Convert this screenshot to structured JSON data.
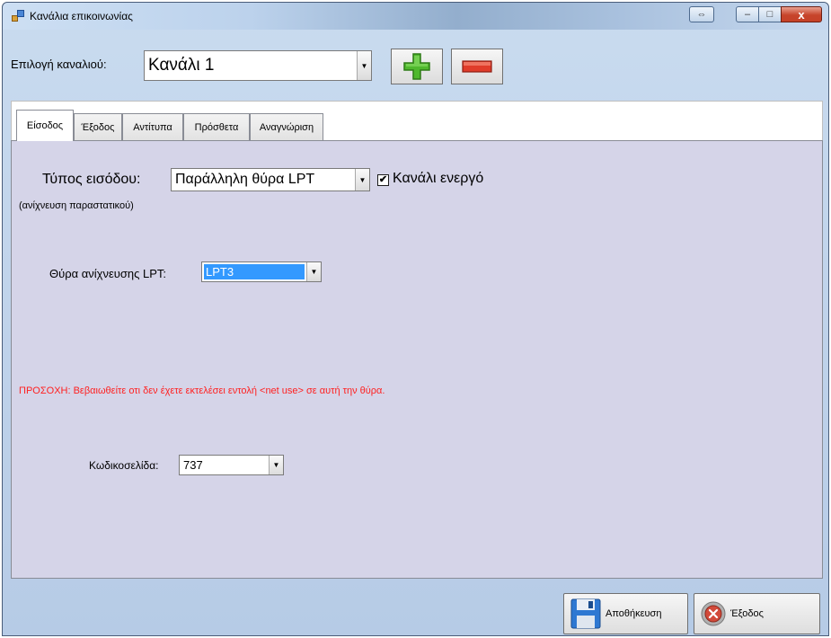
{
  "window": {
    "title": "Κανάλια επικοινωνίας",
    "min_glyph": "–",
    "max_glyph": "□",
    "close_glyph": "x",
    "swap_glyph": "⇔"
  },
  "toolbar": {
    "channel_label": "Επιλογή καναλιού:",
    "channel_value": "Κανάλι 1",
    "add_color": "#4fb82d",
    "remove_color": "#e03c2a"
  },
  "tabs": [
    {
      "label": "Είσοδος",
      "active": true
    },
    {
      "label": "Έξοδος"
    },
    {
      "label": "Αντίτυπα"
    },
    {
      "label": "Πρόσθετα"
    },
    {
      "label": "Αναγνώριση"
    }
  ],
  "input": {
    "type_label": "Τύπος εισόδου:",
    "type_value": "Παράλληλη θύρα LPT",
    "active_label": "Κανάλι ενεργό",
    "active_checked": true,
    "check_glyph": "✔",
    "note": "(ανίχνευση παραστατικού)",
    "lpt_label": "Θύρα ανίχνευσης LPT:",
    "lpt_value": "LPT3",
    "warning": "ΠΡΟΣΟΧΗ: Βεβαιωθείτε οτι δεν έχετε εκτελέσει εντολή <net use> σε αυτή την θύρα.",
    "codepage_label": "Κωδικοσελίδα:",
    "codepage_value": "737"
  },
  "footer": {
    "save_label": "Αποθήκευση",
    "exit_label": "Έξοδος"
  },
  "colors": {
    "tab_page_bg": "#d5d4e8",
    "warning": "#ff2020",
    "selection": "#3399ff"
  }
}
